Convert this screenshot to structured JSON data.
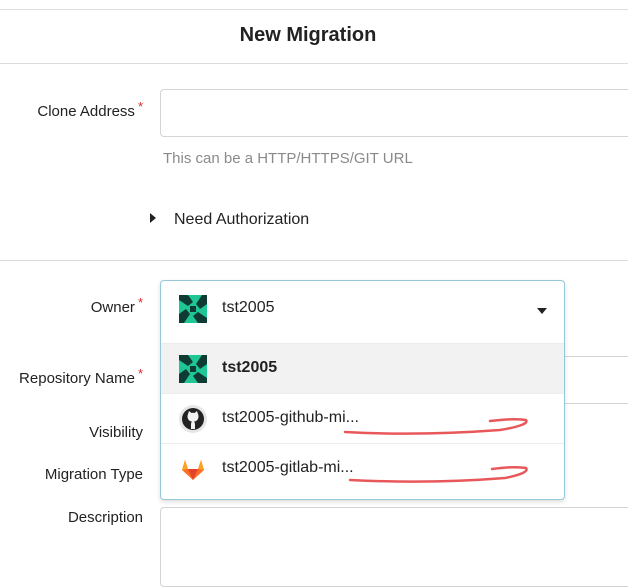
{
  "page": {
    "title": "New Migration"
  },
  "form": {
    "clone_address": {
      "label": "Clone Address",
      "required_mark": "*",
      "value": "",
      "help": "This can be a HTTP/HTTPS/GIT URL"
    },
    "auth_toggle": {
      "label": "Need Authorization"
    },
    "owner": {
      "label": "Owner",
      "required_mark": "*",
      "selected": "tst2005",
      "options": [
        {
          "label": "tst2005",
          "icon": "org-avatar-icon",
          "active": true
        },
        {
          "label": "tst2005-github-mi...",
          "icon": "github-icon",
          "active": false
        },
        {
          "label": "tst2005-gitlab-mi...",
          "icon": "gitlab-icon",
          "active": false
        }
      ]
    },
    "repo_name": {
      "label": "Repository Name",
      "required_mark": "*"
    },
    "visibility": {
      "label": "Visibility"
    },
    "migration_type": {
      "label": "Migration Type"
    },
    "description": {
      "label": "Description",
      "value": ""
    }
  },
  "colors": {
    "required": "#db2828",
    "dropdown_border": "#96c8da",
    "annotation": "#e8585b",
    "avatar_green": "#1ec794"
  }
}
